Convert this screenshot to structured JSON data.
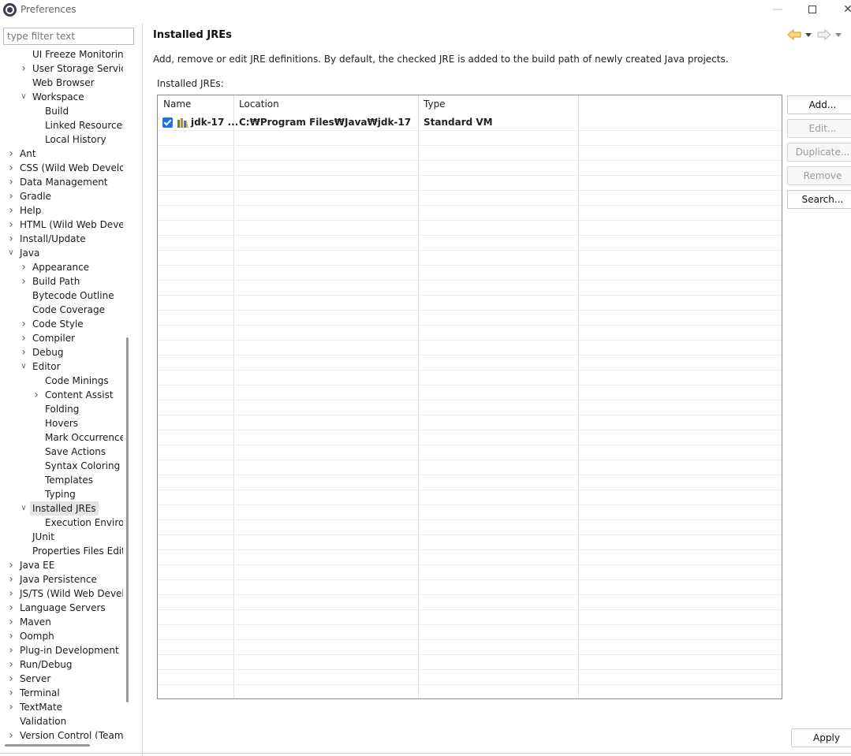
{
  "window": {
    "title": "Preferences"
  },
  "filter": {
    "placeholder": "type filter text"
  },
  "tree": [
    {
      "label": "UI Freeze Monitoring",
      "level": 2,
      "chevron": ""
    },
    {
      "label": "User Storage Service",
      "level": 2,
      "chevron": "collapsed"
    },
    {
      "label": "Web Browser",
      "level": 2,
      "chevron": ""
    },
    {
      "label": "Workspace",
      "level": 2,
      "chevron": "expanded"
    },
    {
      "label": "Build",
      "level": 3,
      "chevron": ""
    },
    {
      "label": "Linked Resources",
      "level": 3,
      "chevron": ""
    },
    {
      "label": "Local History",
      "level": 3,
      "chevron": ""
    },
    {
      "label": "Ant",
      "level": 1,
      "chevron": "collapsed"
    },
    {
      "label": "CSS (Wild Web Develop",
      "level": 1,
      "chevron": "collapsed"
    },
    {
      "label": "Data Management",
      "level": 1,
      "chevron": "collapsed"
    },
    {
      "label": "Gradle",
      "level": 1,
      "chevron": "collapsed"
    },
    {
      "label": "Help",
      "level": 1,
      "chevron": "collapsed"
    },
    {
      "label": "HTML (Wild Web Develo",
      "level": 1,
      "chevron": "collapsed"
    },
    {
      "label": "Install/Update",
      "level": 1,
      "chevron": "collapsed"
    },
    {
      "label": "Java",
      "level": 1,
      "chevron": "expanded"
    },
    {
      "label": "Appearance",
      "level": 2,
      "chevron": "collapsed"
    },
    {
      "label": "Build Path",
      "level": 2,
      "chevron": "collapsed"
    },
    {
      "label": "Bytecode Outline",
      "level": 2,
      "chevron": ""
    },
    {
      "label": "Code Coverage",
      "level": 2,
      "chevron": ""
    },
    {
      "label": "Code Style",
      "level": 2,
      "chevron": "collapsed"
    },
    {
      "label": "Compiler",
      "level": 2,
      "chevron": "collapsed"
    },
    {
      "label": "Debug",
      "level": 2,
      "chevron": "collapsed"
    },
    {
      "label": "Editor",
      "level": 2,
      "chevron": "expanded"
    },
    {
      "label": "Code Minings",
      "level": 3,
      "chevron": ""
    },
    {
      "label": "Content Assist",
      "level": 3,
      "chevron": "collapsed"
    },
    {
      "label": "Folding",
      "level": 3,
      "chevron": ""
    },
    {
      "label": "Hovers",
      "level": 3,
      "chevron": ""
    },
    {
      "label": "Mark Occurrences",
      "level": 3,
      "chevron": ""
    },
    {
      "label": "Save Actions",
      "level": 3,
      "chevron": ""
    },
    {
      "label": "Syntax Coloring",
      "level": 3,
      "chevron": ""
    },
    {
      "label": "Templates",
      "level": 3,
      "chevron": ""
    },
    {
      "label": "Typing",
      "level": 3,
      "chevron": ""
    },
    {
      "label": "Installed JREs",
      "level": 2,
      "chevron": "expanded",
      "selected": true
    },
    {
      "label": "Execution Environ",
      "level": 3,
      "chevron": ""
    },
    {
      "label": "JUnit",
      "level": 2,
      "chevron": ""
    },
    {
      "label": "Properties Files Edito",
      "level": 2,
      "chevron": ""
    },
    {
      "label": "Java EE",
      "level": 1,
      "chevron": "collapsed"
    },
    {
      "label": "Java Persistence",
      "level": 1,
      "chevron": "collapsed"
    },
    {
      "label": "JS/TS (Wild Web Develc",
      "level": 1,
      "chevron": "collapsed"
    },
    {
      "label": "Language Servers",
      "level": 1,
      "chevron": "collapsed"
    },
    {
      "label": "Maven",
      "level": 1,
      "chevron": "collapsed"
    },
    {
      "label": "Oomph",
      "level": 1,
      "chevron": "collapsed"
    },
    {
      "label": "Plug-in Development",
      "level": 1,
      "chevron": "collapsed"
    },
    {
      "label": "Run/Debug",
      "level": 1,
      "chevron": "collapsed"
    },
    {
      "label": "Server",
      "level": 1,
      "chevron": "collapsed"
    },
    {
      "label": "Terminal",
      "level": 1,
      "chevron": "collapsed"
    },
    {
      "label": "TextMate",
      "level": 1,
      "chevron": "collapsed"
    },
    {
      "label": "Validation",
      "level": 1,
      "chevron": ""
    },
    {
      "label": "Version Control (Team)",
      "level": 1,
      "chevron": "collapsed"
    }
  ],
  "page": {
    "title": "Installed JREs",
    "description": "Add, remove or edit JRE definitions. By default, the checked JRE is added to the build path of newly created Java projects.",
    "table_label": "Installed JREs:"
  },
  "table": {
    "columns": [
      "Name",
      "Location",
      "Type"
    ],
    "rows": [
      {
        "name": "jdk-17 ...",
        "location": "C:₩Program Files₩Java₩jdk-17",
        "type": "Standard VM",
        "checked": true
      }
    ]
  },
  "buttons": {
    "add": "Add...",
    "edit": "Edit...",
    "duplicate": "Duplicate...",
    "remove": "Remove",
    "search": "Search...",
    "apply": "Apply"
  }
}
